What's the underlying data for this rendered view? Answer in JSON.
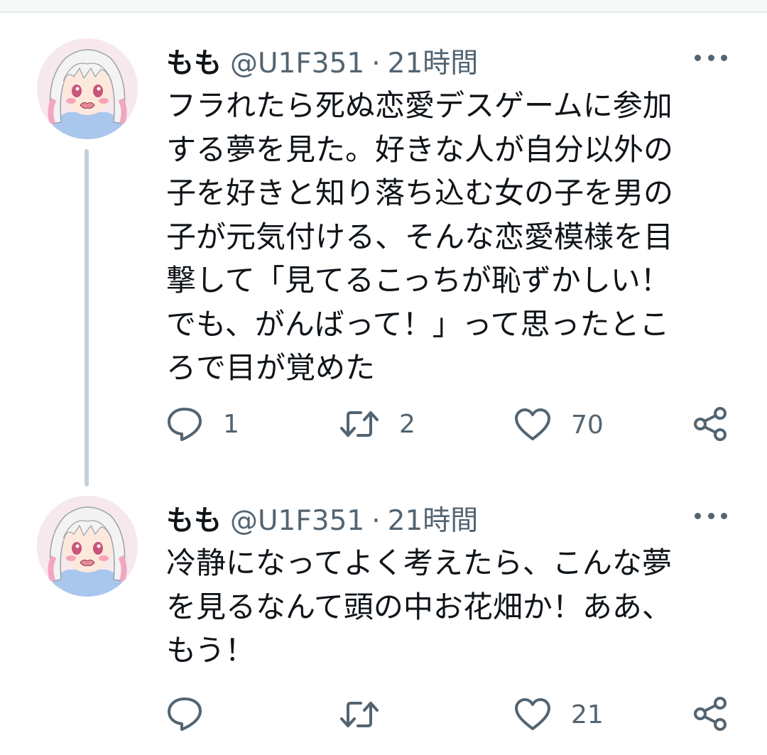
{
  "tweets": [
    {
      "name": "もも",
      "handle": "@U1F351",
      "separator": "·",
      "time": "21時間",
      "lines": [
        "フラれたら死ぬ恋愛デスゲームに参加",
        "する夢を見た。好きな人が自分以外の",
        "子を好きと知り落ち込む女の子を男の",
        "子が元気付ける、そんな恋愛模様を目",
        "撃して「見てるこっちが恥ずかしい！",
        "でも、がんばって！」って思ったとこ",
        "ろで目が覚めた"
      ],
      "actions": {
        "replies": "1",
        "retweets": "2",
        "likes": "70"
      }
    },
    {
      "name": "もも",
      "handle": "@U1F351",
      "separator": "·",
      "time": "21時間",
      "lines": [
        "冷静になってよく考えたら、こんな夢",
        "を見るなんて頭の中お花畑か！ああ、",
        "もう！"
      ],
      "actions": {
        "replies": "",
        "retweets": "",
        "likes": "21"
      }
    }
  ],
  "icons": {
    "reply": "speech-bubble-icon",
    "retweet": "retweet-arrows-icon",
    "like": "heart-outline-icon",
    "share": "share-nodes-icon",
    "more": "three-dots-icon"
  },
  "colors": {
    "text": "#0f1419",
    "muted": "#536471",
    "thread_line": "#c4cfd6"
  }
}
